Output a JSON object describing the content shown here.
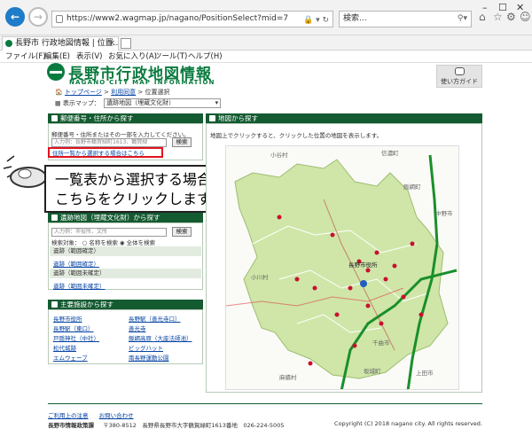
{
  "browser": {
    "url": "https://www2.wagmap.jp/nagano/PositionSelect?mid=7",
    "search_placeholder": "検索...",
    "tab_title": "長野市 行政地図情報 | 位置...",
    "menu": [
      "ファイル(F)",
      "編集(E)",
      "表示(V)",
      "お気に入り(A)",
      "ツール(T)",
      "ヘルプ(H)"
    ]
  },
  "site": {
    "title": "長野市行政地図情報",
    "subtitle": "NAGANO CITY MAP INFORMATION",
    "guide_label": "使い方ガイド",
    "breadcrumb": {
      "home": "トップページ",
      "sep1": " > ",
      "usage": "利用同意",
      "sep2": " > ",
      "current": "位置選択"
    },
    "map_select_label": "表示マップ：",
    "map_select_value": "遺跡地図（埋蔵文化財）"
  },
  "postal_panel": {
    "title": "郵便番号・住所から探す",
    "hint": "郵便番号・住所またはその一部を入力してください。",
    "placeholder": "入力例：長野市鶴賀緑町1613、鶴賀緑",
    "search_button": "検索",
    "list_link": "住所一覧から選択する場合はこちら"
  },
  "callout": {
    "line1": "一覧表から選択する場合は",
    "line2": "こちらをクリックします"
  },
  "site_panel": {
    "title": "遺跡地図（埋蔵文化財）から探す",
    "placeholder": "入力例：市役所、文所",
    "search_button": "検索",
    "target_label": "検索対象：",
    "option1": "名称を検索",
    "option2": "全体を検索",
    "groups": [
      {
        "header": "遺跡（範囲確定）",
        "link": "遺跡（範囲確定）"
      },
      {
        "header": "遺跡（範囲未確定）",
        "link": "遺跡（範囲未確定）"
      }
    ]
  },
  "facility_panel": {
    "title": "主要施設から探す",
    "left": [
      "長野市役所",
      "長野駅（東口）",
      "戸隠神社（中社）",
      "松代城跡",
      "エムウェーブ"
    ],
    "right": [
      "長野駅（善光寺口）",
      "善光寺",
      "飯綱高原（大座法師池）",
      "ビッグハット",
      "南長野運動公園"
    ]
  },
  "map_panel": {
    "title": "地図から探す",
    "hint": "地図上でクリックすると、クリックした位置の地図を表示します。",
    "labels": [
      "小谷村",
      "信濃町",
      "飯綱町",
      "中野市",
      "小川村",
      "長野市役所",
      "千曲市",
      "上田市",
      "麻績村",
      "坂城町"
    ]
  },
  "footer": {
    "links": [
      "ご利用上の注意",
      "お問い合わせ"
    ],
    "org": "長野市情報政策課",
    "postal": "〒380-8512　長野県長野市大字鶴賀緑町1613番地　026-224-5005",
    "copyright": "Copyright (C) 2018 nagano city. All rights reserved."
  }
}
